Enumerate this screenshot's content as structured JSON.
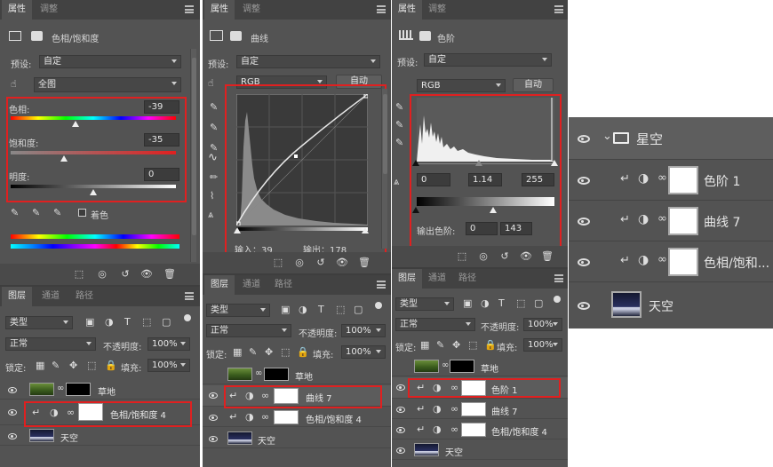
{
  "panel1": {
    "tabs": [
      "属性",
      "调整"
    ],
    "title": "色相/饱和度",
    "preset_label": "预设:",
    "preset_value": "自定",
    "channel_value": "全图",
    "hue_label": "色相:",
    "hue_value": "-39",
    "sat_label": "饱和度:",
    "sat_value": "-35",
    "light_label": "明度:",
    "light_value": "0",
    "colorize_label": "着色",
    "layer_tabs": [
      "图层",
      "通道",
      "路径"
    ],
    "filter_value": "类型",
    "blend_value": "正常",
    "opacity_label": "不透明度:",
    "opacity_value": "100%",
    "lock_label": "锁定:",
    "fill_label": "填充:",
    "fill_value": "100%",
    "layers": [
      "草地",
      "色相/饱和度 4",
      "天空"
    ]
  },
  "panel2": {
    "tabs": [
      "属性",
      "调整"
    ],
    "title": "曲线",
    "preset_label": "预设:",
    "preset_value": "自定",
    "channel_value": "RGB",
    "auto_label": "自动",
    "input_label": "输入：39",
    "output_label": "输出：178",
    "layer_tabs": [
      "图层",
      "通道",
      "路径"
    ],
    "filter_value": "类型",
    "blend_value": "正常",
    "opacity_label": "不透明度:",
    "opacity_value": "100%",
    "lock_label": "锁定:",
    "fill_label": "填充:",
    "fill_value": "100%",
    "layers": [
      "草地",
      "曲线 7",
      "色相/饱和度 4",
      "天空"
    ]
  },
  "panel3": {
    "tabs": [
      "属性",
      "调整"
    ],
    "title": "色阶",
    "preset_label": "预设:",
    "preset_value": "自定",
    "channel_value": "RGB",
    "auto_label": "自动",
    "in_black": "0",
    "in_gamma": "1.14",
    "in_white": "255",
    "output_label": "输出色阶:",
    "out_black": "0",
    "out_white": "143",
    "layer_tabs": [
      "图层",
      "通道",
      "路径"
    ],
    "filter_value": "类型",
    "blend_value": "正常",
    "opacity_label": "不透明度:",
    "opacity_value": "100%",
    "lock_label": "锁定:",
    "fill_label": "填充:",
    "fill_value": "100%",
    "layers": [
      "草地",
      "色阶 1",
      "曲线 7",
      "色相/饱和度 4",
      "天空"
    ]
  },
  "panel4": {
    "group_name": "星空",
    "layers": [
      "色阶 1",
      "曲线 7",
      "色相/饱和...",
      "天空"
    ]
  },
  "colors": {
    "panel_bg": "#535353",
    "tab_bg": "#424242",
    "highlight": "#e02020"
  }
}
